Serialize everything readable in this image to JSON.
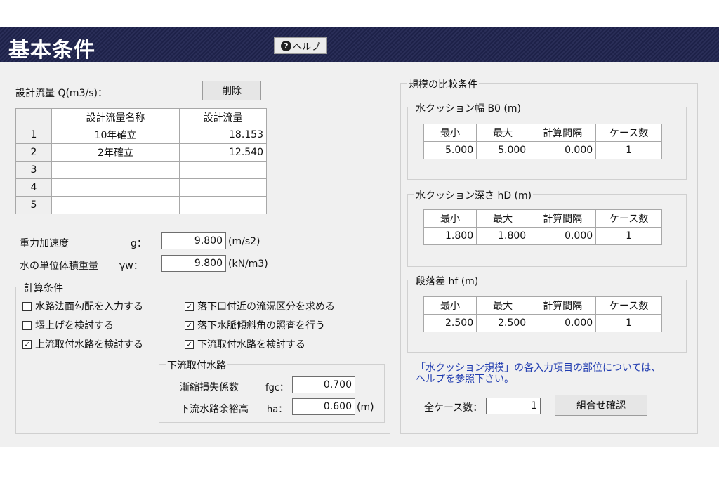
{
  "header": {
    "title": "基本条件",
    "help_label": "ヘルプ",
    "help_icon": "question-circle-icon"
  },
  "design_flow": {
    "label": "設計流量 Q(m3/s)：",
    "delete_label": "削除",
    "columns": [
      "設計流量名称",
      "設計流量"
    ],
    "rows": [
      {
        "no": "1",
        "name": "10年確立",
        "flow": "18.153"
      },
      {
        "no": "2",
        "name": "2年確立",
        "flow": "12.540"
      },
      {
        "no": "3",
        "name": "",
        "flow": ""
      },
      {
        "no": "4",
        "name": "",
        "flow": ""
      },
      {
        "no": "5",
        "name": "",
        "flow": ""
      }
    ]
  },
  "gravity": {
    "label": "重力加速度",
    "symbol": "g：",
    "value": "9.800",
    "unit": "(m/s2)"
  },
  "unit_weight": {
    "label": "水の単位体積重量",
    "symbol": "γw：",
    "value": "9.800",
    "unit": "(kN/m3)"
  },
  "calc_conditions": {
    "legend": "計算条件",
    "left": [
      {
        "label": "水路法面勾配を入力する",
        "checked": false
      },
      {
        "label": "堰上げを検討する",
        "checked": false
      },
      {
        "label": "上流取付水路を検討する",
        "checked": true
      }
    ],
    "right": [
      {
        "label": "落下口付近の流況区分を求める",
        "checked": true
      },
      {
        "label": "落下水脈傾斜角の照査を行う",
        "checked": true
      },
      {
        "label": "下流取付水路を検討する",
        "checked": true
      }
    ]
  },
  "downstream": {
    "legend": "下流取付水路",
    "taper_label": "漸縮損失係数",
    "taper_symbol": "fgc：",
    "taper_value": "0.700",
    "margin_label": "下流水路余裕高",
    "margin_symbol": "ha：",
    "margin_value": "0.600",
    "margin_unit": "(m)"
  },
  "scale": {
    "legend": "規模の比較条件",
    "columns": [
      "最小",
      "最大",
      "計算間隔",
      "ケース数"
    ],
    "groups": [
      {
        "legend": "水クッション幅 B0 (m)",
        "values": [
          "5.000",
          "5.000",
          "0.000",
          "1"
        ]
      },
      {
        "legend": "水クッション深さ hD (m)",
        "values": [
          "1.800",
          "1.800",
          "0.000",
          "1"
        ]
      },
      {
        "legend": "段落差 hf (m)",
        "values": [
          "2.500",
          "2.500",
          "0.000",
          "1"
        ]
      }
    ],
    "note_line1": "「水クッション規模」の各入力項目の部位については、",
    "note_line2": "ヘルプを参照下さい。",
    "total_label": "全ケース数：",
    "total_value": "1",
    "combo_label": "組合せ確認"
  }
}
